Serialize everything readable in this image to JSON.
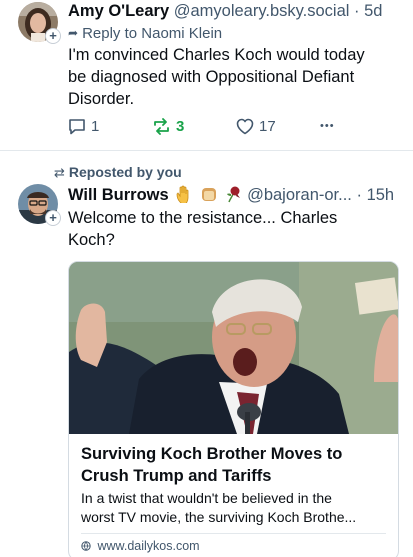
{
  "post1": {
    "author_name": "Amy O'Leary",
    "handle": "@amyoleary.bsky.social",
    "separator": "·",
    "time": "5d",
    "reply_prefix": "Reply to",
    "reply_to": "Naomi Klein",
    "text_lines": [
      "I'm convinced Charles Koch would today",
      "be diagnosed with Oppositional Defiant",
      "Disorder."
    ],
    "reply_count": "1",
    "repost_count": "3",
    "like_count": "17",
    "more_label": "•••",
    "follow_badge": "+"
  },
  "post2": {
    "repost_label": "Reposted by you",
    "author_name": "Will Burrows",
    "author_emojis": [
      "raised-hand-emoji",
      "bread-emoji",
      "wilted-rose-emoji"
    ],
    "handle": "@bajoran-or...",
    "separator": "·",
    "time": "15h",
    "text_lines": [
      "Welcome to the resistance... Charles",
      "Koch?"
    ],
    "follow_badge": "+",
    "link_card": {
      "image": "photo of an older man in suit shouting with raised fist at a podium",
      "title_lines": [
        "Surviving Koch Brother Moves to",
        "Crush Trump and Tariffs"
      ],
      "description_lines": [
        "In a twist that wouldn't be believed in the",
        "worst TV movie, the surviving Koch Brothe..."
      ],
      "url": "www.dailykos.com"
    }
  },
  "colors": {
    "text_primary": "#0b0f14",
    "text_secondary": "#42576c",
    "repost_green": "#1aa34a",
    "divider": "#e3e8ec"
  }
}
